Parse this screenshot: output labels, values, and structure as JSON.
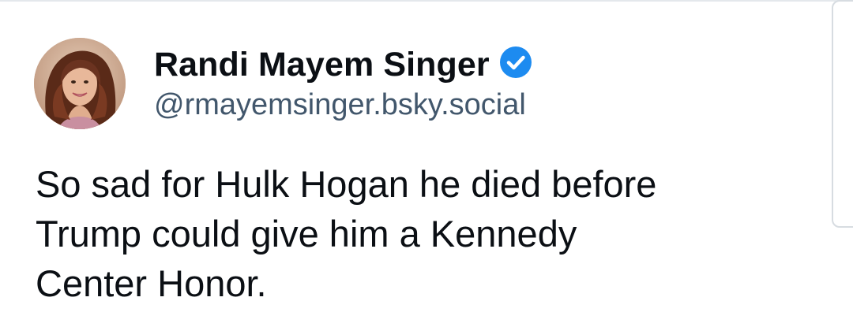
{
  "post": {
    "author": {
      "display_name": "Randi Mayem Singer",
      "handle": "@rmayemsinger.bsky.social",
      "verified": true,
      "verified_icon": "verified-check-icon",
      "verified_color": "#1d8bf0"
    },
    "text": "So sad for Hulk Hogan he died before\nTrump could give him a Kennedy\nCenter Honor."
  },
  "colors": {
    "name_text": "#0b0f14",
    "handle_text": "#42576c",
    "post_text": "#0b0f14",
    "border": "#e4e8ec"
  }
}
